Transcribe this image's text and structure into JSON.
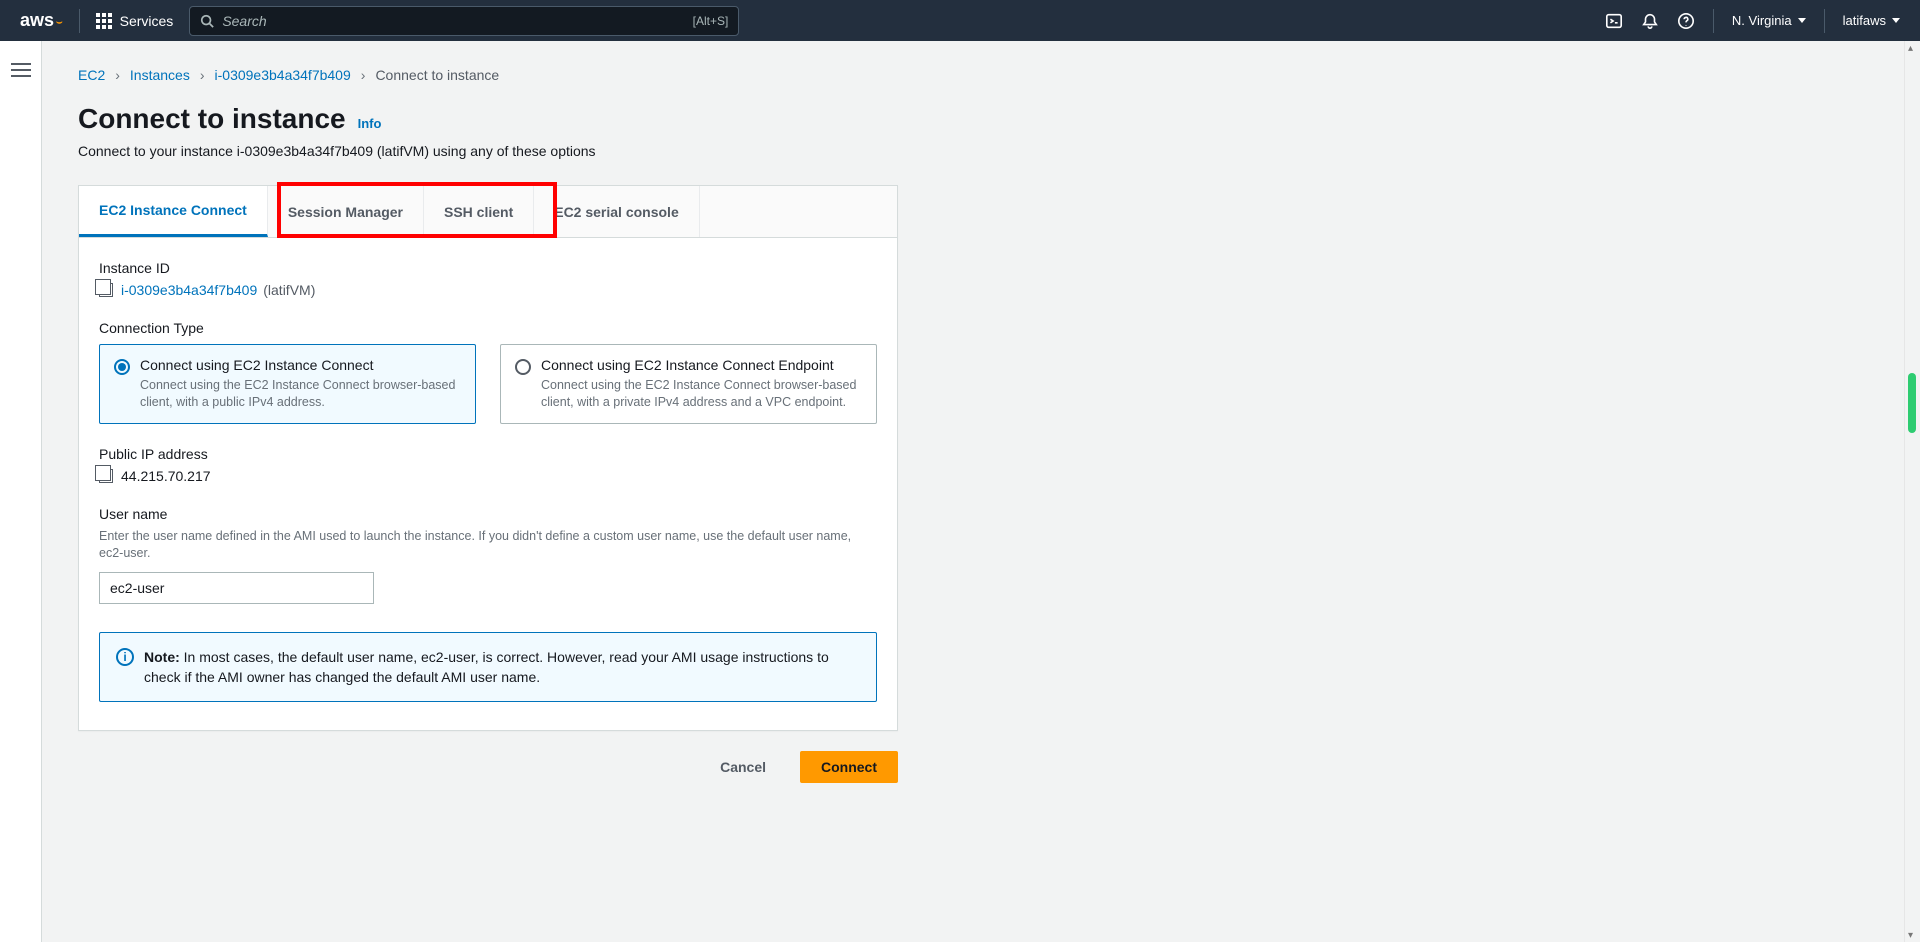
{
  "topnav": {
    "logo": "aws",
    "services_label": "Services",
    "search_placeholder": "Search",
    "search_shortcut": "[Alt+S]",
    "region": "N. Virginia",
    "user": "latifaws"
  },
  "breadcrumb": {
    "items": [
      "EC2",
      "Instances",
      "i-0309e3b4a34f7b409"
    ],
    "current": "Connect to instance"
  },
  "header": {
    "title": "Connect to instance",
    "info": "Info",
    "subtitle": "Connect to your instance i-0309e3b4a34f7b409 (latifVM) using any of these options"
  },
  "tabs": [
    "EC2 Instance Connect",
    "Session Manager",
    "SSH client",
    "EC2 serial console"
  ],
  "instance": {
    "label": "Instance ID",
    "id": "i-0309e3b4a34f7b409",
    "name": "(latifVM)"
  },
  "connection_type": {
    "label": "Connection Type",
    "options": [
      {
        "title": "Connect using EC2 Instance Connect",
        "desc": "Connect using the EC2 Instance Connect browser-based client, with a public IPv4 address.",
        "selected": true
      },
      {
        "title": "Connect using EC2 Instance Connect Endpoint",
        "desc": "Connect using the EC2 Instance Connect browser-based client, with a private IPv4 address and a VPC endpoint.",
        "selected": false
      }
    ]
  },
  "public_ip": {
    "label": "Public IP address",
    "value": "44.215.70.217"
  },
  "username": {
    "label": "User name",
    "help": "Enter the user name defined in the AMI used to launch the instance. If you didn't define a custom user name, use the default user name, ec2-user.",
    "value": "ec2-user"
  },
  "note": {
    "prefix": "Note:",
    "text": " In most cases, the default user name, ec2-user, is correct. However, read your AMI usage instructions to check if the AMI owner has changed the default AMI user name."
  },
  "buttons": {
    "cancel": "Cancel",
    "connect": "Connect"
  }
}
